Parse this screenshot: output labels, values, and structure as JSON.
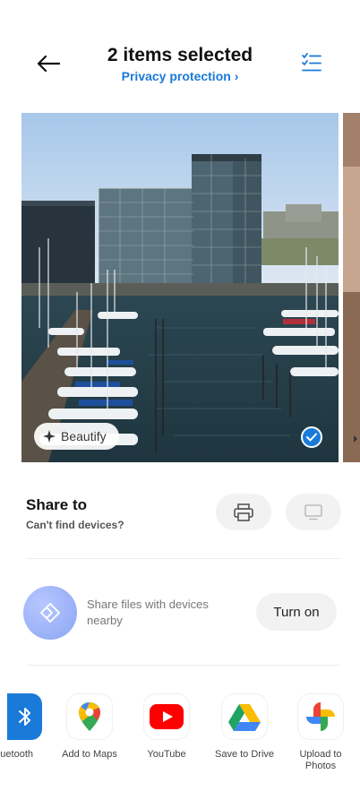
{
  "header": {
    "title": "2 items selected",
    "subtitle": "Privacy protection",
    "subtitle_chevron": "›",
    "back_icon": "arrow-left-icon",
    "select_all_icon": "checklist-icon",
    "accent_color": "#1a7ad9"
  },
  "carousel": {
    "beautify_label": "Beautify",
    "beautify_icon": "sparkle-icon",
    "selected_icon": "check-circle-icon"
  },
  "share": {
    "title": "Share to",
    "subtitle": "Can't find devices?",
    "print_icon": "printer-icon",
    "device_icon": "monitor-icon"
  },
  "nearby": {
    "text": "Share files with devices nearby",
    "button_label": "Turn on",
    "icon": "nearby-share-icon"
  },
  "apps": [
    {
      "label": "uetooth",
      "icon": "bluetooth-icon"
    },
    {
      "label": "Add to Maps",
      "icon": "maps-icon"
    },
    {
      "label": "YouTube",
      "icon": "youtube-icon"
    },
    {
      "label": "Save to Drive",
      "icon": "drive-icon"
    },
    {
      "label": "Upload to Photos",
      "icon": "photos-icon"
    }
  ]
}
